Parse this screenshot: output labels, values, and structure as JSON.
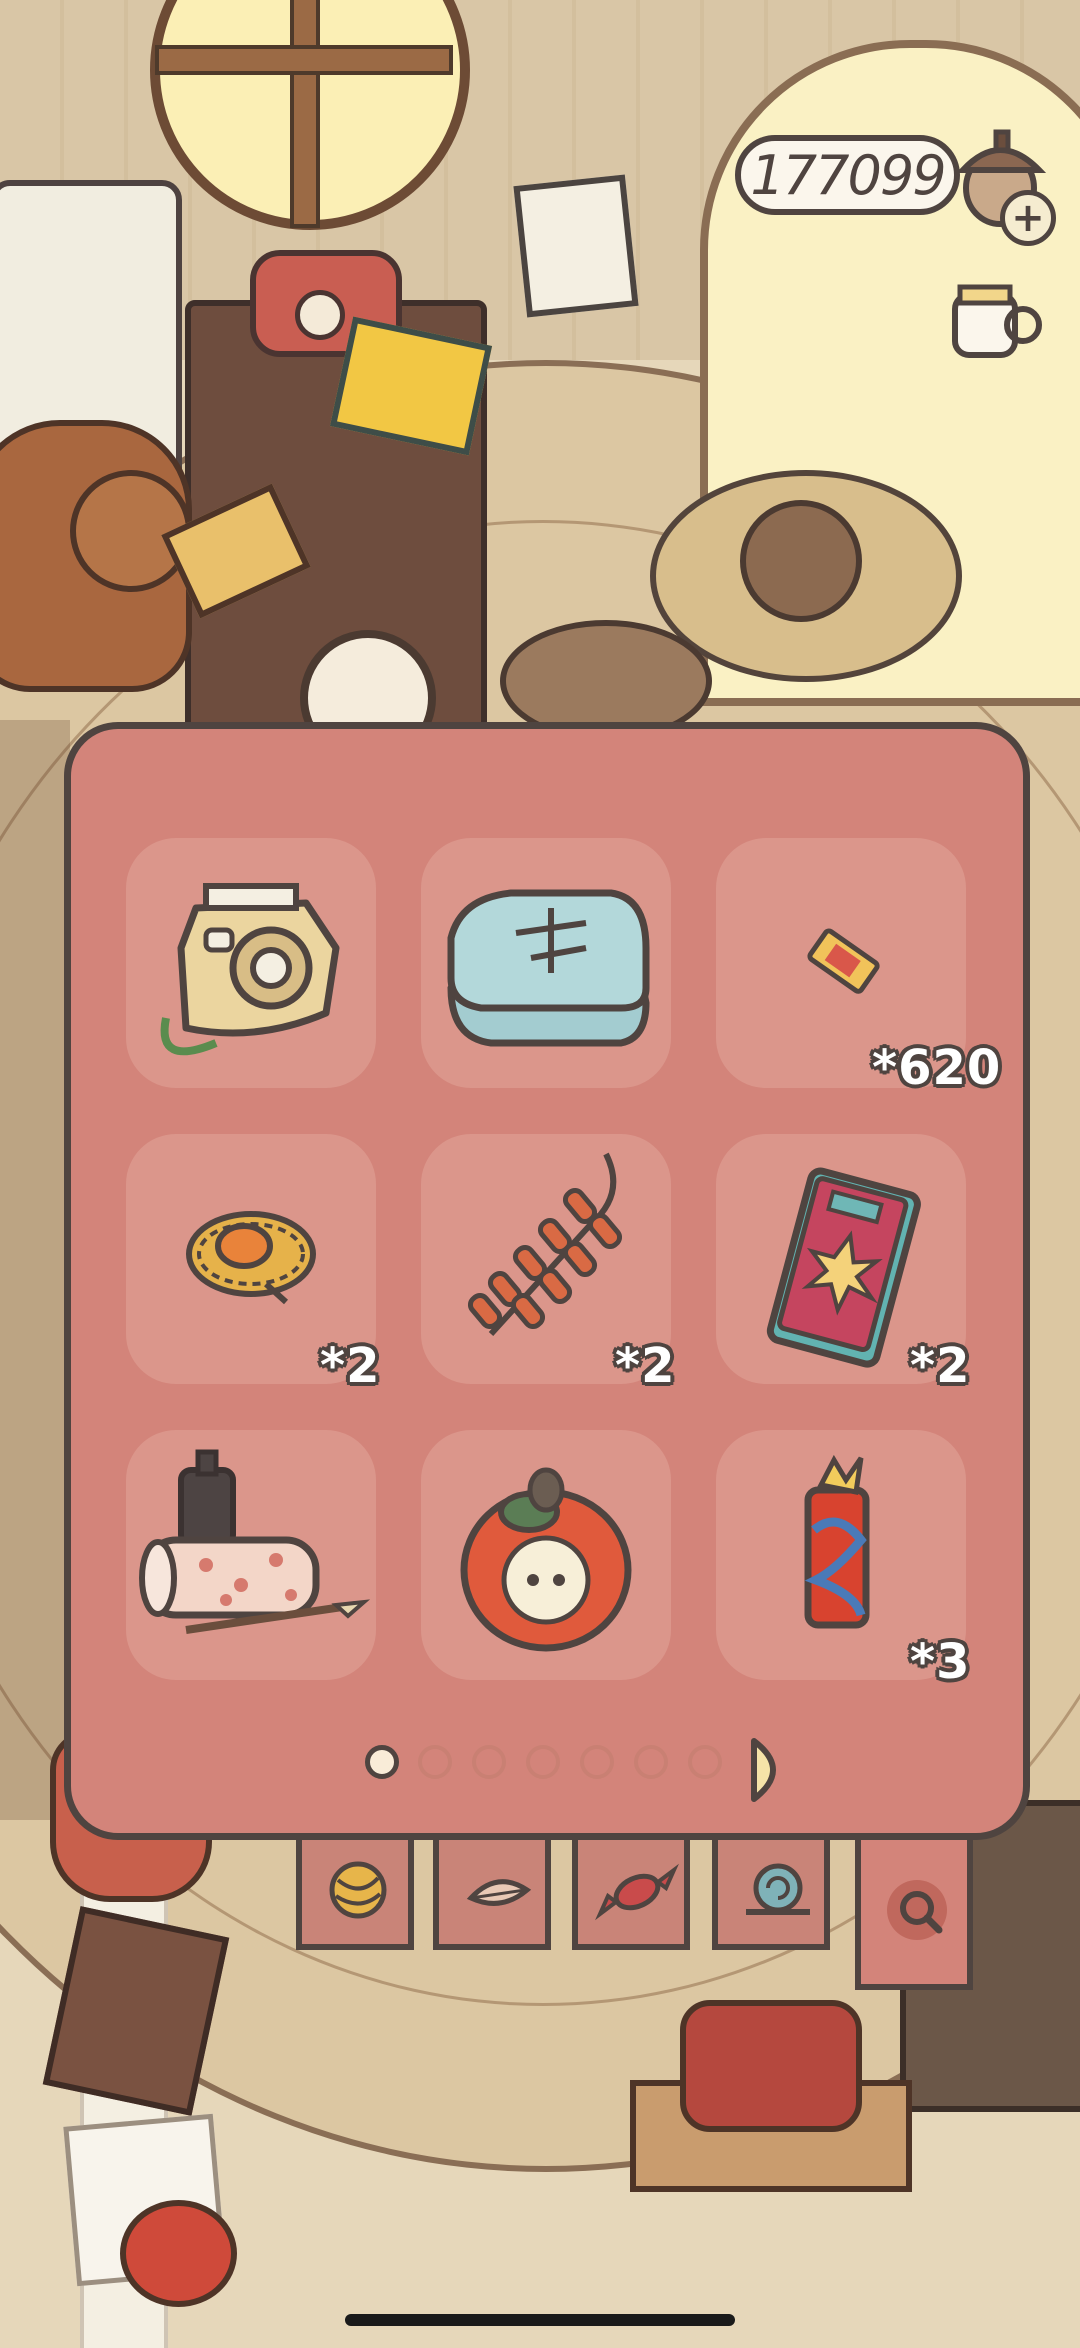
{
  "currency": {
    "amount": "177099",
    "icon": "acorn-icon",
    "add_icon": "plus-icon",
    "add_label": "+"
  },
  "inventory": {
    "page_count": 7,
    "current_page": 1,
    "items": [
      {
        "icon": "instant-camera-icon",
        "count": ""
      },
      {
        "icon": "folded-blue-cloth-icon",
        "count": ""
      },
      {
        "icon": "ticket-icon",
        "count": "*620"
      },
      {
        "icon": "straw-hat-icon",
        "count": "*2"
      },
      {
        "icon": "firecracker-string-icon",
        "count": "*2"
      },
      {
        "icon": "firework-box-icon",
        "count": "*2"
      },
      {
        "icon": "paper-roll-and-ink-icon",
        "count": ""
      },
      {
        "icon": "persimmon-icon",
        "count": ""
      },
      {
        "icon": "firework-tube-icon",
        "count": "*3"
      }
    ]
  },
  "tabs": [
    {
      "icon": "yarn-ball-icon"
    },
    {
      "icon": "leaf-icon"
    },
    {
      "icon": "candy-icon"
    },
    {
      "icon": "snail-icon"
    },
    {
      "icon": "magnifier-icon"
    }
  ],
  "colors": {
    "panel": "#d3847a",
    "slot": "#db968b",
    "outline": "#4f4440",
    "count_text": "#ffffff"
  }
}
